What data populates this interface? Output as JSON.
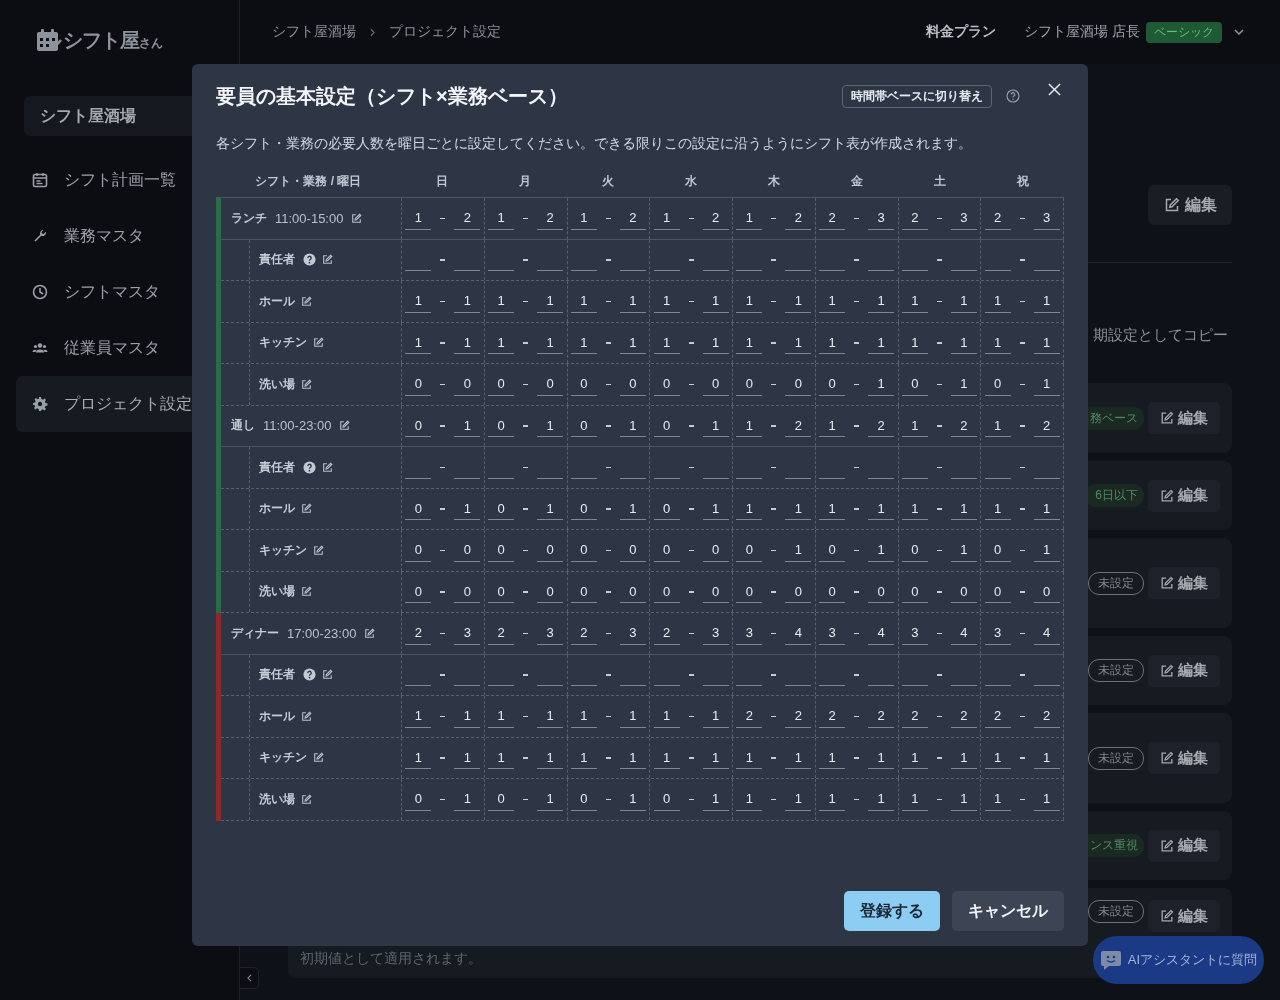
{
  "sidebar": {
    "logo": {
      "main": "シフト屋",
      "suffix": "さん"
    },
    "project_select": "シフト屋酒場",
    "items": [
      {
        "label": "シフト計画一覧",
        "selected": false
      },
      {
        "label": "業務マスタ",
        "selected": false
      },
      {
        "label": "シフトマスタ",
        "selected": false
      },
      {
        "label": "従業員マスタ",
        "selected": false
      },
      {
        "label": "プロジェクト設定",
        "selected": true
      }
    ]
  },
  "header": {
    "breadcrumb": [
      "シフト屋酒場",
      "プロジェクト設定"
    ],
    "pricing_link": "料金プラン",
    "user": "シフト屋酒場 店長",
    "plan_badge": "ベーシック"
  },
  "content": {
    "edit_button": "編集",
    "copy_text": "期設定としてコピー",
    "cards": [
      {
        "tag": "務ベース",
        "kind": "filled",
        "button": "編集"
      },
      {
        "tag": "6日以下",
        "kind": "filled",
        "button": "編集"
      },
      {
        "tag": "未設定",
        "kind": "outline",
        "button": "編集"
      },
      {
        "tag": "未設定",
        "kind": "outline",
        "button": "編集"
      },
      {
        "tag": "未設定",
        "kind": "outline",
        "button": "編集"
      },
      {
        "tag": "ンス重視",
        "kind": "filled",
        "button": "編集"
      },
      {
        "tag": "未設定",
        "kind": "outline",
        "button": "編集",
        "note": "初期値として適用されます。"
      }
    ]
  },
  "ai_button": "AIアシスタントに質問",
  "modal": {
    "title": "要員の基本設定（シフト×業務ベース）",
    "switch_button": "時間帯ベースに切り替え",
    "description": "各シフト・業務の必要人数を曜日ごとに設定してください。できる限りこの設定に沿うようにシフト表が作成されます。",
    "corner_header": "シフト・業務 / 曜日",
    "days": [
      "日",
      "月",
      "火",
      "水",
      "木",
      "金",
      "土",
      "祝"
    ],
    "groups": [
      {
        "name": "ランチ",
        "time": "11:00-15:00",
        "color": "#2a6b48",
        "cells": [
          [
            "1",
            "2"
          ],
          [
            "1",
            "2"
          ],
          [
            "1",
            "2"
          ],
          [
            "1",
            "2"
          ],
          [
            "1",
            "2"
          ],
          [
            "2",
            "3"
          ],
          [
            "2",
            "3"
          ],
          [
            "2",
            "3"
          ]
        ],
        "tasks": [
          {
            "name": "責任者",
            "help": true
          },
          {
            "name": "ホール",
            "help": false,
            "cells": [
              [
                "1",
                "1"
              ],
              [
                "1",
                "1"
              ],
              [
                "1",
                "1"
              ],
              [
                "1",
                "1"
              ],
              [
                "1",
                "1"
              ],
              [
                "1",
                "1"
              ],
              [
                "1",
                "1"
              ],
              [
                "1",
                "1"
              ]
            ]
          },
          {
            "name": "キッチン",
            "help": false,
            "cells": [
              [
                "1",
                "1"
              ],
              [
                "1",
                "1"
              ],
              [
                "1",
                "1"
              ],
              [
                "1",
                "1"
              ],
              [
                "1",
                "1"
              ],
              [
                "1",
                "1"
              ],
              [
                "1",
                "1"
              ],
              [
                "1",
                "1"
              ]
            ]
          },
          {
            "name": "洗い場",
            "help": false,
            "cells": [
              [
                "0",
                "0"
              ],
              [
                "0",
                "0"
              ],
              [
                "0",
                "0"
              ],
              [
                "0",
                "0"
              ],
              [
                "0",
                "0"
              ],
              [
                "0",
                "1"
              ],
              [
                "0",
                "1"
              ],
              [
                "0",
                "1"
              ]
            ]
          }
        ]
      },
      {
        "name": "通し",
        "time": "11:00-23:00",
        "color": "#2a6b48",
        "cells": [
          [
            "0",
            "1"
          ],
          [
            "0",
            "1"
          ],
          [
            "0",
            "1"
          ],
          [
            "0",
            "1"
          ],
          [
            "1",
            "2"
          ],
          [
            "1",
            "2"
          ],
          [
            "1",
            "2"
          ],
          [
            "1",
            "2"
          ]
        ],
        "tasks": [
          {
            "name": "責任者",
            "help": true
          },
          {
            "name": "ホール",
            "help": false,
            "cells": [
              [
                "0",
                "1"
              ],
              [
                "0",
                "1"
              ],
              [
                "0",
                "1"
              ],
              [
                "0",
                "1"
              ],
              [
                "1",
                "1"
              ],
              [
                "1",
                "1"
              ],
              [
                "1",
                "1"
              ],
              [
                "1",
                "1"
              ]
            ]
          },
          {
            "name": "キッチン",
            "help": false,
            "cells": [
              [
                "0",
                "0"
              ],
              [
                "0",
                "0"
              ],
              [
                "0",
                "0"
              ],
              [
                "0",
                "0"
              ],
              [
                "0",
                "1"
              ],
              [
                "0",
                "1"
              ],
              [
                "0",
                "1"
              ],
              [
                "0",
                "1"
              ]
            ]
          },
          {
            "name": "洗い場",
            "help": false,
            "cells": [
              [
                "0",
                "0"
              ],
              [
                "0",
                "0"
              ],
              [
                "0",
                "0"
              ],
              [
                "0",
                "0"
              ],
              [
                "0",
                "0"
              ],
              [
                "0",
                "0"
              ],
              [
                "0",
                "0"
              ],
              [
                "0",
                "0"
              ]
            ]
          }
        ]
      },
      {
        "name": "ディナー",
        "time": "17:00-23:00",
        "color": "#8b2a2a",
        "cells": [
          [
            "2",
            "3"
          ],
          [
            "2",
            "3"
          ],
          [
            "2",
            "3"
          ],
          [
            "2",
            "3"
          ],
          [
            "3",
            "4"
          ],
          [
            "3",
            "4"
          ],
          [
            "3",
            "4"
          ],
          [
            "3",
            "4"
          ]
        ],
        "tasks": [
          {
            "name": "責任者",
            "help": true
          },
          {
            "name": "ホール",
            "help": false,
            "cells": [
              [
                "1",
                "1"
              ],
              [
                "1",
                "1"
              ],
              [
                "1",
                "1"
              ],
              [
                "1",
                "1"
              ],
              [
                "2",
                "2"
              ],
              [
                "2",
                "2"
              ],
              [
                "2",
                "2"
              ],
              [
                "2",
                "2"
              ]
            ]
          },
          {
            "name": "キッチン",
            "help": false,
            "cells": [
              [
                "1",
                "1"
              ],
              [
                "1",
                "1"
              ],
              [
                "1",
                "1"
              ],
              [
                "1",
                "1"
              ],
              [
                "1",
                "1"
              ],
              [
                "1",
                "1"
              ],
              [
                "1",
                "1"
              ],
              [
                "1",
                "1"
              ]
            ]
          },
          {
            "name": "洗い場",
            "help": false,
            "cells": [
              [
                "0",
                "1"
              ],
              [
                "0",
                "1"
              ],
              [
                "0",
                "1"
              ],
              [
                "0",
                "1"
              ],
              [
                "1",
                "1"
              ],
              [
                "1",
                "1"
              ],
              [
                "1",
                "1"
              ],
              [
                "1",
                "1"
              ]
            ]
          }
        ]
      }
    ],
    "submit_button": "登録する",
    "cancel_button": "キャンセル"
  }
}
